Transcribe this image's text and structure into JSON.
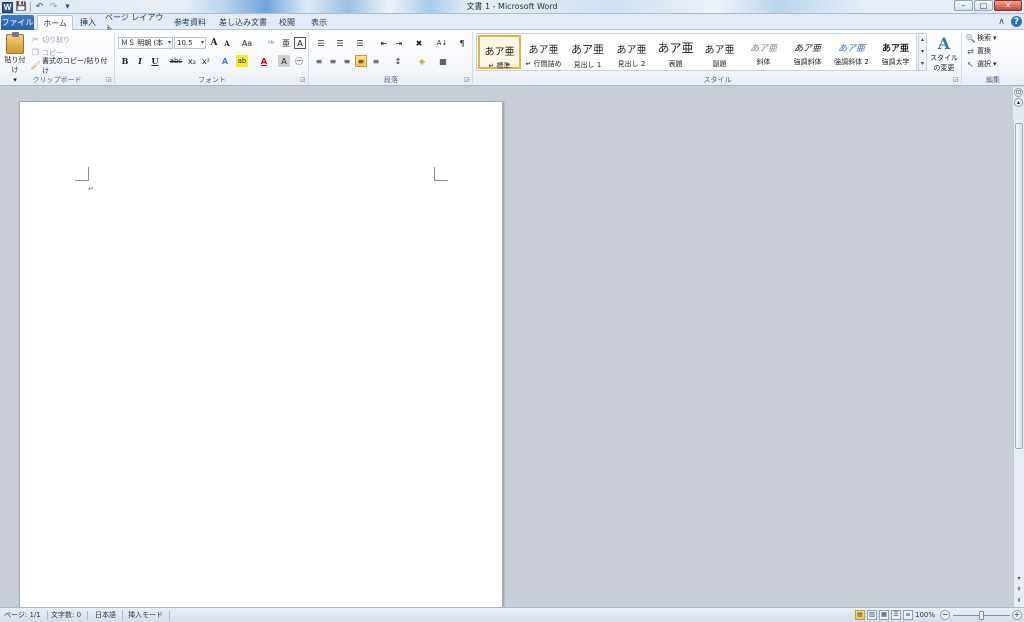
{
  "window": {
    "title": "文書 1 - Microsoft Word",
    "app_logo": "W",
    "controls": {
      "minimize": "–",
      "maximize": "□",
      "close": "✕"
    }
  },
  "qat": {
    "icons": [
      "save-icon",
      "undo-icon",
      "redo-icon",
      "customize-icon"
    ],
    "glyphs": {
      "save": "💾",
      "undo": "↶",
      "redo": "↷",
      "customize": "▾"
    }
  },
  "tabs": {
    "file": "ファイル",
    "home": "ホーム",
    "insert": "挿入",
    "layout": "ページ レイアウト",
    "references": "参考資料",
    "mailings": "差し込み文書",
    "review": "校閲",
    "view": "表示"
  },
  "tabright": {
    "minimize_ribbon": "∧",
    "help": "?"
  },
  "clipboard": {
    "label": "クリップボード",
    "paste": "貼り付け",
    "cut": "切り取り",
    "copy": "コピー",
    "format_painter": "書式のコピー/貼り付け"
  },
  "font": {
    "label": "フォント",
    "font_name": "ＭＳ 明朝 (本",
    "font_size": "10.5",
    "grow": "A",
    "shrink": "A",
    "case": "Aa",
    "clear": "ᴬᵇ",
    "phonetic": "亜",
    "border_char": "A",
    "bold": "B",
    "italic": "I",
    "underline": "U",
    "strike": "abc",
    "subscript": "x₂",
    "superscript": "x²",
    "effects": "A",
    "highlight": "ab",
    "font_color": "A",
    "shade_char": "A",
    "enclose": "㊀"
  },
  "paragraph": {
    "label": "段落",
    "bullets": "☰",
    "numbering": "☰",
    "multilevel": "☰",
    "decrease_indent": "⇤",
    "increase_indent": "⇥",
    "asian_layout": "✖",
    "sort": "A↓",
    "show_marks": "¶",
    "align_left": "≡",
    "center": "≡",
    "align_right": "≡",
    "justify": "≡",
    "distributed": "≡",
    "line_spacing": "↕",
    "shading": "◈",
    "borders": "▦"
  },
  "styles": {
    "label": "スタイル",
    "items": [
      {
        "sample": "あア亜",
        "name": "↵ 標準"
      },
      {
        "sample": "あア亜",
        "name": "↵ 行間詰め"
      },
      {
        "sample": "あア亜",
        "name": "見出し 1"
      },
      {
        "sample": "あア亜",
        "name": "見出し 2"
      },
      {
        "sample": "あア亜",
        "name": "表題"
      },
      {
        "sample": "あア亜",
        "name": "副題"
      },
      {
        "sample": "あア亜",
        "name": "斜体"
      },
      {
        "sample": "あア亜",
        "name": "強調斜体"
      },
      {
        "sample": "あア亜",
        "name": "強調斜体 2"
      },
      {
        "sample": "あア亜",
        "name": "強調太字"
      }
    ],
    "change_styles": "スタイルの変更",
    "change_glyph": "A"
  },
  "editing": {
    "label": "編集",
    "find": "検索",
    "replace": "置換",
    "select": "選択"
  },
  "document": {
    "paragraph_mark": "↵"
  },
  "statusbar": {
    "page": "ページ: 1/1",
    "words": "文字数: 0",
    "language": "日本語",
    "mode": "挿入モード",
    "zoom": "100%",
    "zoom_minus": "−",
    "zoom_plus": "+"
  },
  "colors": {
    "file_tab": "#2a5fa8",
    "accent": "#2b579a",
    "selected_style": "#e4b14b",
    "workspace": "#c9ced6"
  }
}
